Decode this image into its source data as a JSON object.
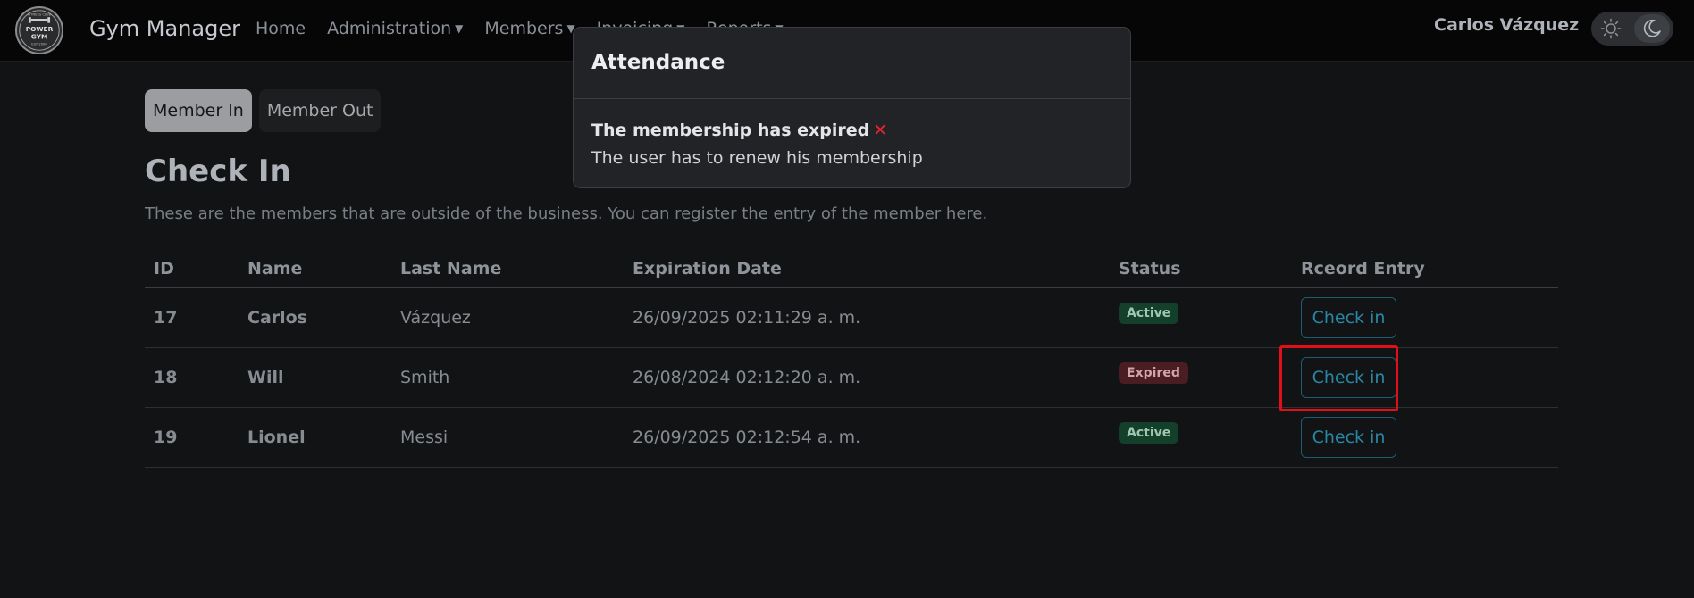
{
  "nav": {
    "brand": "Gym Manager",
    "items": [
      {
        "label": "Home",
        "dropdown": false
      },
      {
        "label": "Administration",
        "dropdown": true
      },
      {
        "label": "Members",
        "dropdown": true
      },
      {
        "label": "Invoicing",
        "dropdown": true
      },
      {
        "label": "Reports",
        "dropdown": true
      }
    ],
    "user_name": "Carlos Vázquez",
    "logo_text": {
      "top": "FITNESS CLUB",
      "line1": "POWER",
      "line2": "GYM",
      "bottom": "EST 2000"
    },
    "theme_icons": [
      "sun-icon",
      "moon-icon"
    ]
  },
  "tabs": {
    "member_in": "Member In",
    "member_out": "Member Out",
    "active": "member_in"
  },
  "page": {
    "title": "Check In",
    "description": "These are the members that are outside of the business. You can register the entry of the member here."
  },
  "table": {
    "headers": [
      "ID",
      "Name",
      "Last Name",
      "Expiration Date",
      "Status",
      "Rceord Entry"
    ],
    "rows": [
      {
        "id": "17",
        "name": "Carlos",
        "last_name": "Vázquez",
        "expiration": "26/09/2025 02:11:29 a. m.",
        "status": "Active",
        "action": "Check in"
      },
      {
        "id": "18",
        "name": "Will",
        "last_name": "Smith",
        "expiration": "26/08/2024 02:12:20 a. m.",
        "status": "Expired",
        "action": "Check in"
      },
      {
        "id": "19",
        "name": "Lionel",
        "last_name": "Messi",
        "expiration": "26/09/2025 02:12:54 a. m.",
        "status": "Active",
        "action": "Check in"
      }
    ]
  },
  "modal": {
    "title": "Attendance",
    "message": "The membership has expired",
    "message_icon": "✕",
    "submessage": "The user has to renew his membership"
  },
  "colors": {
    "background": "#121315",
    "navbar": "#060607",
    "active_badge": "#143f2a",
    "expired_badge": "#4a1d23",
    "button_outline": "#2a87a4",
    "highlight": "#e0101a",
    "error_icon": "#e5242f"
  }
}
